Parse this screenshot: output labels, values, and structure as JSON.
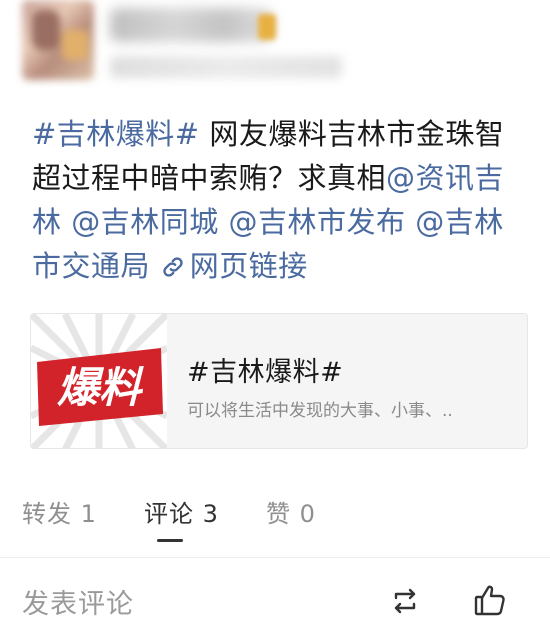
{
  "post": {
    "hashtag": "#吉林爆料#",
    "line1_rest": " 网友爆料吉林市金珠智",
    "line2_start": "超过程中暗中索贿？求真相",
    "mention1": "@资讯吉林",
    "mention2": "@吉林同城",
    "mention3": "@吉林市发布",
    "mention4": "@吉林市交通局",
    "link_text": "网页链接",
    "link_icon": "link-icon"
  },
  "card": {
    "thumb_text": "爆料",
    "title": "#吉林爆料#",
    "description": "可以将生活中发现的大事、小事、.."
  },
  "actions": {
    "repost": "转发 1",
    "comment": "评论 3",
    "like": "赞 0",
    "active": "comment"
  },
  "comment_bar": {
    "placeholder": "发表评论",
    "repost_icon": "repost-icon",
    "like_icon": "thumbs-up-icon"
  },
  "colors": {
    "link_blue": "#4a6aa0",
    "thumb_red": "#d2232a",
    "muted_gray": "#8f8f8f"
  }
}
